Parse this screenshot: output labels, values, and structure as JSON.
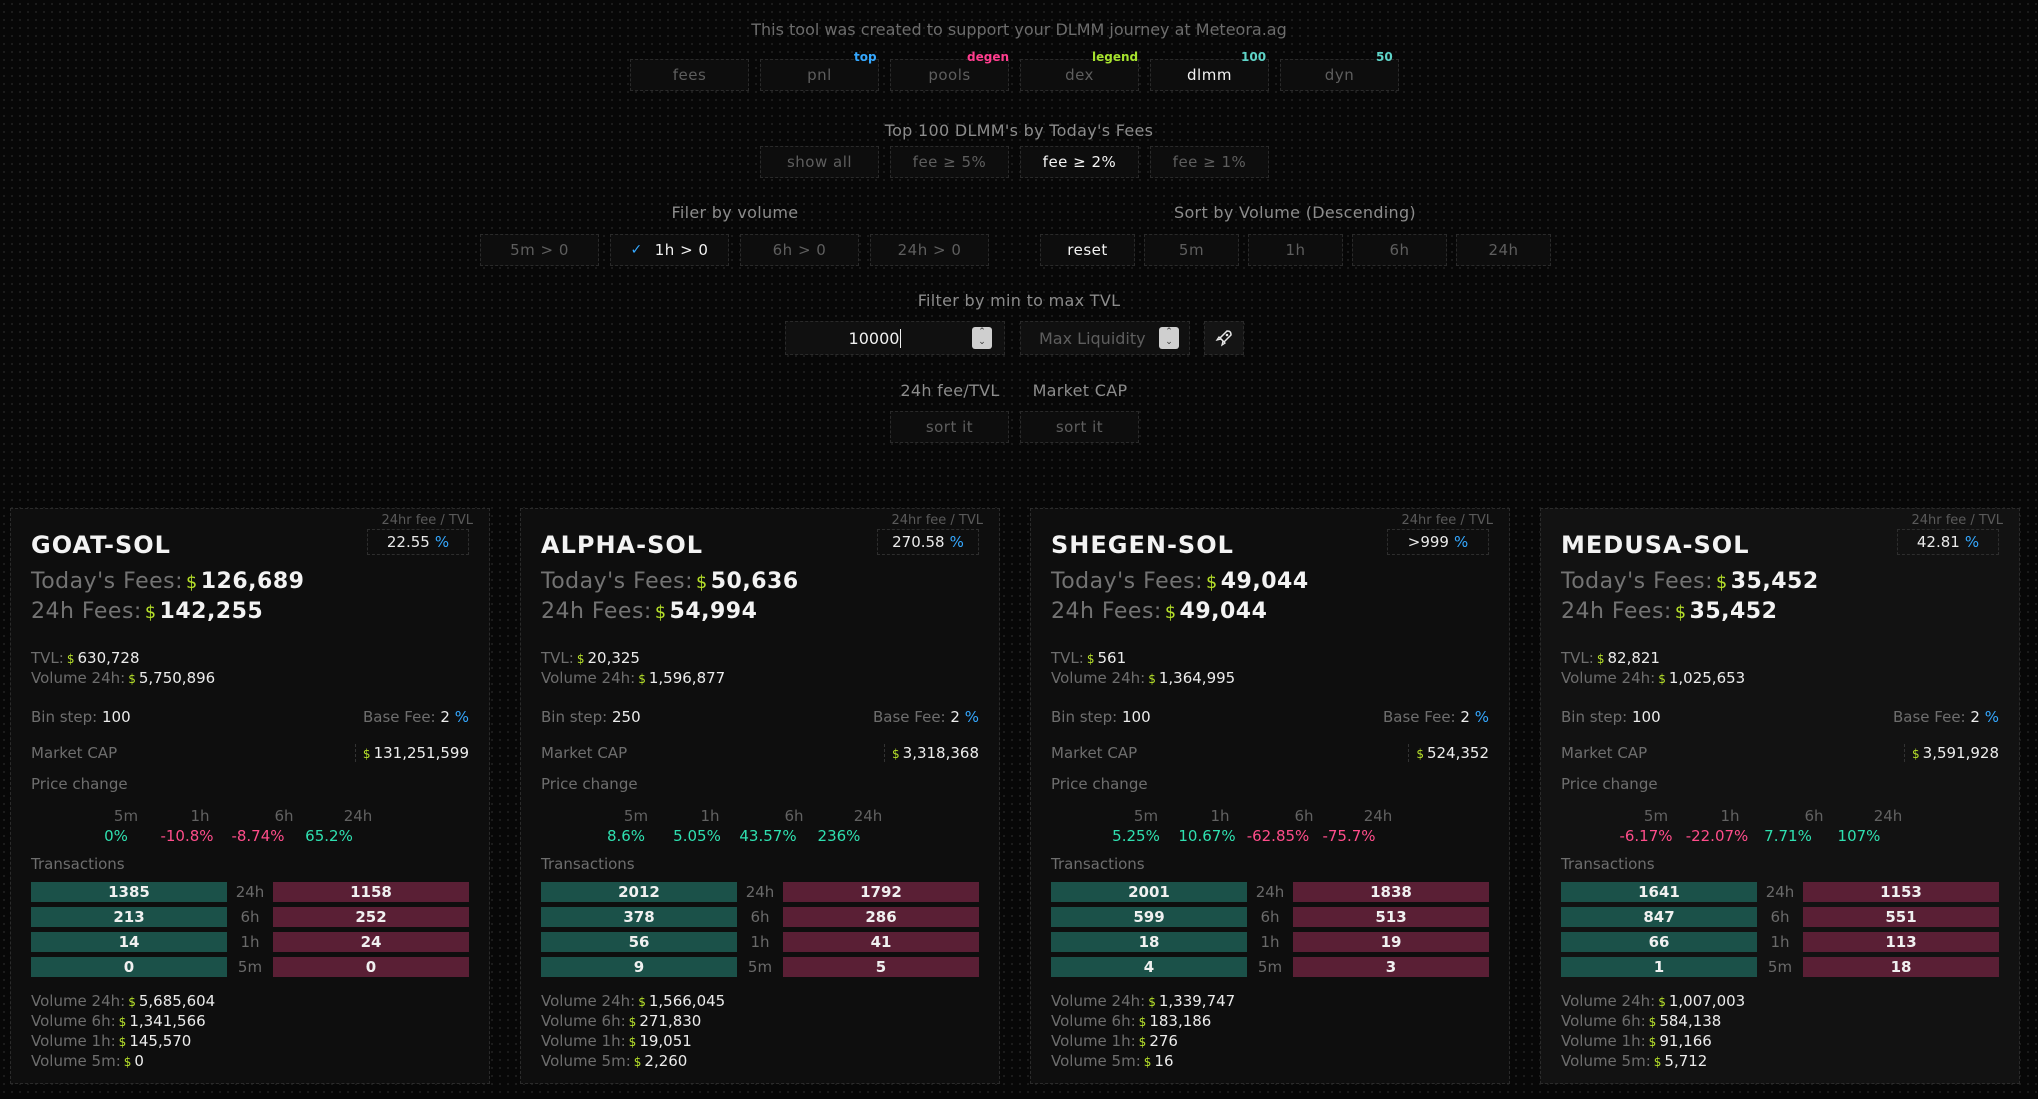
{
  "header": {
    "tagline": "This tool was created to support your DLMM journey at Meteora.ag",
    "nav": [
      {
        "label": "fees",
        "tag": "",
        "tag_color": "",
        "active": false
      },
      {
        "label": "pnl",
        "tag": "top",
        "tag_color": "#35a8ff",
        "active": false
      },
      {
        "label": "pools",
        "tag": "degen",
        "tag_color": "#ff3d8e",
        "active": false
      },
      {
        "label": "dex",
        "tag": "legend",
        "tag_color": "#a6e22e",
        "active": false
      },
      {
        "label": "dlmm",
        "tag": "100",
        "tag_color": "#5fd4c8",
        "active": true
      },
      {
        "label": "dyn",
        "tag": "50",
        "tag_color": "#5fd4c8",
        "active": false
      }
    ]
  },
  "fee_filter": {
    "title": "Top 100 DLMM's by Today's Fees",
    "buttons": [
      {
        "label": "show all",
        "active": false
      },
      {
        "label": "fee ≥ 5%",
        "active": false
      },
      {
        "label": "fee ≥ 2%",
        "active": true
      },
      {
        "label": "fee ≥ 1%",
        "active": false
      }
    ]
  },
  "volume_filter": {
    "title": "Filer by volume",
    "buttons": [
      {
        "label": "5m > 0",
        "checked": false
      },
      {
        "label": "1h > 0",
        "checked": true
      },
      {
        "label": "6h > 0",
        "checked": false
      },
      {
        "label": "24h > 0",
        "checked": false
      }
    ],
    "check_glyph": "✓"
  },
  "volume_sort": {
    "title": "Sort by Volume (Descending)",
    "buttons": [
      {
        "label": "reset",
        "active": true
      },
      {
        "label": "5m",
        "active": false
      },
      {
        "label": "1h",
        "active": false
      },
      {
        "label": "6h",
        "active": false
      },
      {
        "label": "24h",
        "active": false
      }
    ]
  },
  "tvl_filter": {
    "title": "Filter by min to max TVL",
    "min_value": "10000",
    "max_placeholder": "Max Liquidity",
    "go_icon": "rocket-icon"
  },
  "sorts": [
    {
      "label": "24h fee/TVL",
      "button": "sort it"
    },
    {
      "label": "Market CAP",
      "button": "sort it"
    }
  ],
  "labels": {
    "ratio": "24hr fee / TVL",
    "pct": "%",
    "today_fees": "Today's Fees:",
    "fees_24h": "24h Fees:",
    "tvl": "TVL:",
    "volume_24h": "Volume 24h:",
    "bin_step": "Bin step:",
    "base_fee": "Base Fee:",
    "market_cap": "Market CAP",
    "price_change": "Price change",
    "transactions": "Transactions",
    "periods": [
      "5m",
      "1h",
      "6h",
      "24h"
    ],
    "tx_periods": [
      "24h",
      "6h",
      "1h",
      "5m"
    ],
    "vol_24h": "Volume 24h:",
    "vol_6h": "Volume 6h:",
    "vol_1h": "Volume 1h:",
    "vol_5m": "Volume 5m:",
    "dollar": "$"
  },
  "cards": [
    {
      "pair": "GOAT-SOL",
      "ratio": "22.55",
      "today_fees": "126,689",
      "fees_24h": "142,255",
      "tvl": "630,728",
      "volume_24h": "5,750,896",
      "bin_step": "100",
      "base_fee": "2",
      "market_cap": "131,251,599",
      "price_change": [
        "0%",
        "-10.8%",
        "-8.74%",
        "65.2%"
      ],
      "price_signs": [
        "pos",
        "neg",
        "neg",
        "pos"
      ],
      "tx_buys": [
        "1385",
        "213",
        "14",
        "0"
      ],
      "tx_sells": [
        "1158",
        "252",
        "24",
        "0"
      ],
      "vol_24h": "5,685,604",
      "vol_6h": "1,341,566",
      "vol_1h": "145,570",
      "vol_5m": "0"
    },
    {
      "pair": "ALPHA-SOL",
      "ratio": "270.58",
      "today_fees": "50,636",
      "fees_24h": "54,994",
      "tvl": "20,325",
      "volume_24h": "1,596,877",
      "bin_step": "250",
      "base_fee": "2",
      "market_cap": "3,318,368",
      "price_change": [
        "8.6%",
        "5.05%",
        "43.57%",
        "236%"
      ],
      "price_signs": [
        "pos",
        "pos",
        "pos",
        "pos"
      ],
      "tx_buys": [
        "2012",
        "378",
        "56",
        "9"
      ],
      "tx_sells": [
        "1792",
        "286",
        "41",
        "5"
      ],
      "vol_24h": "1,566,045",
      "vol_6h": "271,830",
      "vol_1h": "19,051",
      "vol_5m": "2,260"
    },
    {
      "pair": "SHEGEN-SOL",
      "ratio": ">999",
      "today_fees": "49,044",
      "fees_24h": "49,044",
      "tvl": "561",
      "volume_24h": "1,364,995",
      "bin_step": "100",
      "base_fee": "2",
      "market_cap": "524,352",
      "price_change": [
        "5.25%",
        "10.67%",
        "-62.85%",
        "-75.7%"
      ],
      "price_signs": [
        "pos",
        "pos",
        "neg",
        "neg"
      ],
      "tx_buys": [
        "2001",
        "599",
        "18",
        "4"
      ],
      "tx_sells": [
        "1838",
        "513",
        "19",
        "3"
      ],
      "vol_24h": "1,339,747",
      "vol_6h": "183,186",
      "vol_1h": "276",
      "vol_5m": "16"
    },
    {
      "pair": "MEDUSA-SOL",
      "ratio": "42.81",
      "today_fees": "35,452",
      "fees_24h": "35,452",
      "tvl": "82,821",
      "volume_24h": "1,025,653",
      "bin_step": "100",
      "base_fee": "2",
      "market_cap": "3,591,928",
      "price_change": [
        "-6.17%",
        "-22.07%",
        "7.71%",
        "107%"
      ],
      "price_signs": [
        "neg",
        "neg",
        "pos",
        "pos"
      ],
      "tx_buys": [
        "1641",
        "847",
        "66",
        "1"
      ],
      "tx_sells": [
        "1153",
        "551",
        "113",
        "18"
      ],
      "vol_24h": "1,007,003",
      "vol_6h": "584,138",
      "vol_1h": "91,166",
      "vol_5m": "5,712"
    }
  ]
}
